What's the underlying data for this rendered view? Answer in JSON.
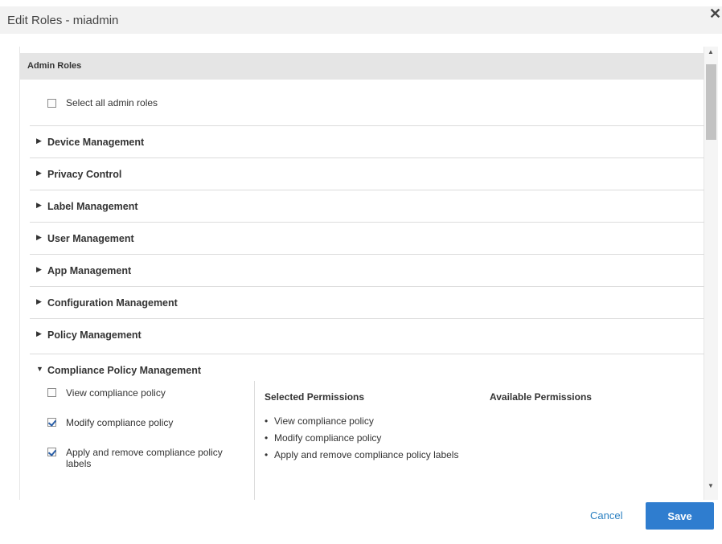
{
  "dialog": {
    "title": "Edit Roles - miadmin",
    "close_glyph": "✕"
  },
  "admin_roles": {
    "header": "Admin Roles",
    "select_all_label": "Select all admin roles",
    "select_all_checked": false
  },
  "sections": [
    {
      "label": "Device Management",
      "expanded": false
    },
    {
      "label": "Privacy Control",
      "expanded": false
    },
    {
      "label": "Label Management",
      "expanded": false
    },
    {
      "label": "User Management",
      "expanded": false
    },
    {
      "label": "App Management",
      "expanded": false
    },
    {
      "label": "Configuration Management",
      "expanded": false
    },
    {
      "label": "Policy Management",
      "expanded": false
    }
  ],
  "compliance": {
    "label": "Compliance Policy Management",
    "expanded": true,
    "permissions": [
      {
        "label": "View compliance policy",
        "checked": false
      },
      {
        "label": "Modify compliance policy",
        "checked": true
      },
      {
        "label": "Apply and remove compliance policy labels",
        "checked": true
      }
    ],
    "selected_header": "Selected Permissions",
    "available_header": "Available Permissions",
    "selected_list": [
      "View compliance policy",
      "Modify compliance policy",
      "Apply and remove compliance policy labels"
    ]
  },
  "footer": {
    "cancel_label": "Cancel",
    "save_label": "Save"
  },
  "colors": {
    "accent": "#2f7dcf",
    "link": "#2a7fc1",
    "header_bg": "#e5e5e5"
  }
}
